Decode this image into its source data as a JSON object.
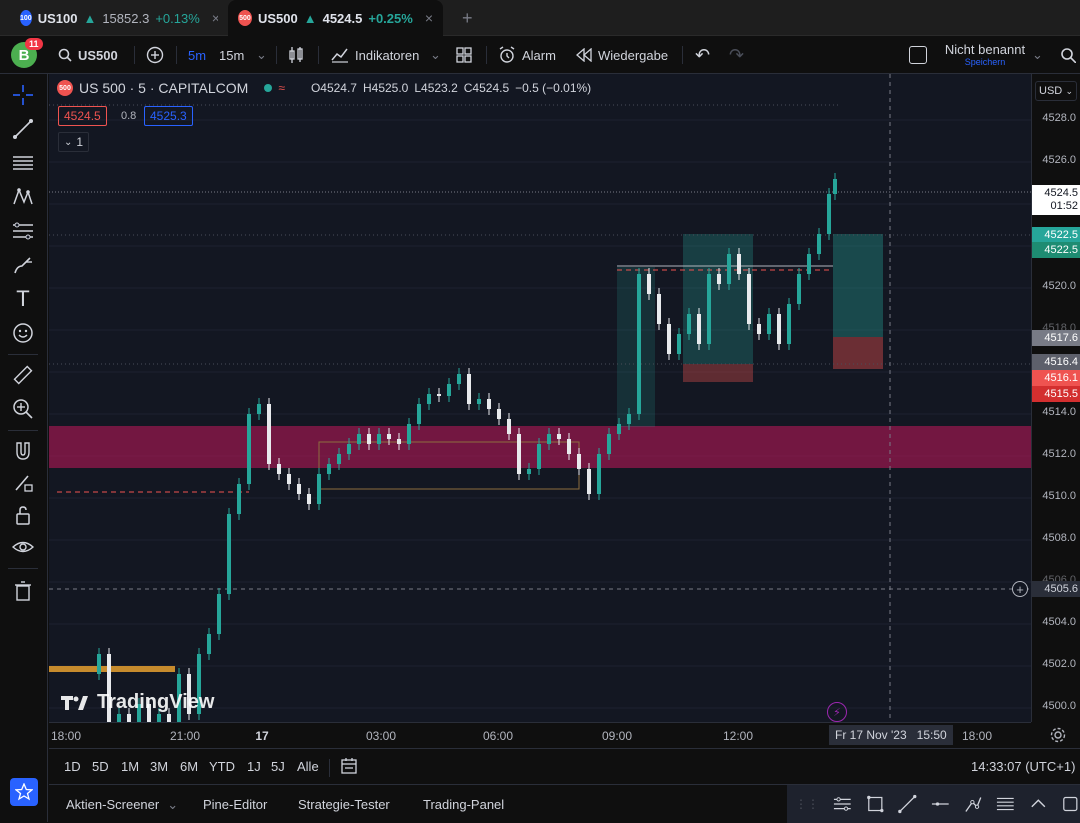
{
  "tabs": [
    {
      "badge": "100",
      "symbol": "US100",
      "price": "15852.3",
      "change": "+0.13%",
      "arrow": "▲",
      "close": "×",
      "active": false
    },
    {
      "badge": "500",
      "symbol": "US500",
      "price": "4524.5",
      "change": "+0.25%",
      "arrow": "▲",
      "close": "×",
      "active": true
    }
  ],
  "new_tab": "+",
  "toolbar": {
    "avatar_letter": "B",
    "avatar_count": "11",
    "symbol_search": "US500",
    "interval_active": "5m",
    "interval_other": "15m",
    "indicators": "Indikatoren",
    "alarm": "Alarm",
    "replay": "Wiedergabe",
    "layout_name": "Nicht benannt",
    "layout_sub": "Speichern"
  },
  "legend": {
    "badge": "500",
    "title": "US 500 · 5 · CAPITALCOM",
    "open": "O4524.7",
    "high": "H4525.0",
    "low": "L4523.2",
    "close": "C4524.5",
    "change": "−0.5 (−0.01%)",
    "bid": "4524.5",
    "spread": "0.8",
    "ask": "4525.3",
    "indicator_count": "1"
  },
  "watermark": "TradingView",
  "currency": "USD",
  "price_scale": [
    "4528.0",
    "4526.0",
    "4520.0",
    "4518.0",
    "4514.0",
    "4512.0",
    "4510.0",
    "4508.0",
    "4506.0",
    "4504.0",
    "4502.0",
    "4500.0"
  ],
  "price_tags": {
    "last": "4524.5",
    "countdown": "01:52",
    "tp1": "4522.5",
    "tp2": "4522.5",
    "entry": "4517.6",
    "stop_a": "4516.4",
    "stop_b": "4516.1",
    "stop_c": "4515.5",
    "crosshair": "4505.6"
  },
  "time_axis": [
    "18:00",
    "21:00",
    "17",
    "03:00",
    "06:00",
    "09:00",
    "12:00",
    "18:00"
  ],
  "time_crosshair": "Fr 17 Nov '23   15:50",
  "ranges": [
    "1D",
    "5D",
    "1M",
    "3M",
    "6M",
    "YTD",
    "1J",
    "5J",
    "Alle"
  ],
  "clock": "14:33:07 (UTC+1)",
  "bottom_tabs": [
    "Aktien-Screener",
    "Pine-Editor",
    "Strategie-Tester",
    "Trading-Panel"
  ],
  "colors": {
    "up": "#26a69a",
    "down": "#ef5350",
    "zone": "#c2185b",
    "accent": "#2962ff",
    "bg": "#131722"
  }
}
